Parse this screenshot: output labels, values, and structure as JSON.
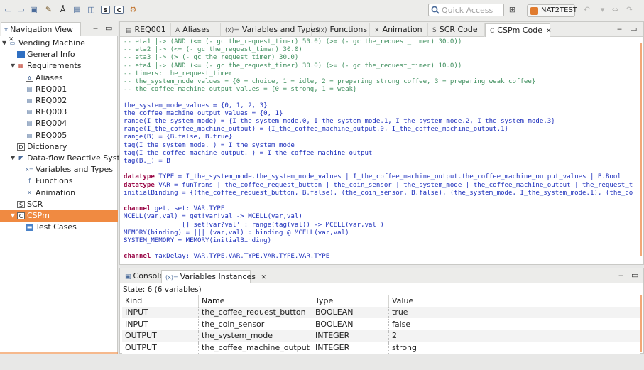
{
  "toolbar": {
    "quick_access_placeholder": "Quick Access",
    "perspective_label": "NAT2TEST"
  },
  "nav": {
    "title": "Navigation View",
    "items": [
      {
        "label": "Vending Machine",
        "icon": "project-icon"
      },
      {
        "label": "General Info",
        "icon": "info-icon"
      },
      {
        "label": "Requirements",
        "icon": "requirements-icon"
      },
      {
        "label": "Aliases",
        "icon": "alias-icon"
      },
      {
        "label": "REQ001",
        "icon": "req-icon"
      },
      {
        "label": "REQ002",
        "icon": "req-icon"
      },
      {
        "label": "REQ003",
        "icon": "req-icon"
      },
      {
        "label": "REQ004",
        "icon": "req-icon"
      },
      {
        "label": "REQ005",
        "icon": "req-icon"
      },
      {
        "label": "Dictionary",
        "icon": "dictionary-icon"
      },
      {
        "label": "Data-flow Reactive System",
        "icon": "dfrs-icon"
      },
      {
        "label": "Variables and Types",
        "icon": "variables-icon"
      },
      {
        "label": "Functions",
        "icon": "functions-icon"
      },
      {
        "label": "Animation",
        "icon": "animation-icon"
      },
      {
        "label": "SCR",
        "icon": "scr-icon"
      },
      {
        "label": "CSPm",
        "icon": "cspm-icon"
      },
      {
        "label": "Test Cases",
        "icon": "testcases-icon"
      }
    ]
  },
  "editor": {
    "tabs": [
      {
        "label": "REQ001",
        "glyph": "▤"
      },
      {
        "label": "Aliases",
        "glyph": "A"
      },
      {
        "label": "Variables and Types",
        "glyph": "(x)="
      },
      {
        "label": "Functions",
        "glyph": "f(x)"
      },
      {
        "label": "Animation",
        "glyph": "✕"
      },
      {
        "label": "SCR Code",
        "glyph": "S"
      },
      {
        "label": "CSPm Code",
        "glyph": "C"
      }
    ],
    "code": [
      [
        [
          "cmt",
          "-- eta1 |-> (AND (<= (- gc the_request_timer) 50.0) (>= (- gc the_request_timer) 30.0))"
        ]
      ],
      [
        [
          "cmt",
          "-- eta2 |-> (<= (- gc the_request_timer) 30.0)"
        ]
      ],
      [
        [
          "cmt",
          "-- eta3 |-> (> (- gc the_request_timer) 30.0)"
        ]
      ],
      [
        [
          "cmt",
          "-- eta4 |-> (AND (<= (- gc the_request_timer) 30.0) (>= (- gc the_request_timer) 10.0))"
        ]
      ],
      [
        [
          "cmt",
          "-- timers: the_request_timer"
        ]
      ],
      [
        [
          "cmt",
          "-- the_system_mode values = {0 = choice, 1 = idle, 2 = preparing strong coffee, 3 = preparing weak coffee}"
        ]
      ],
      [
        [
          "cmt",
          "-- the_coffee_machine_output values = {0 = strong, 1 = weak}"
        ]
      ],
      [],
      [
        [
          "",
          "the_system_mode_values = {0, 1, 2, 3}"
        ]
      ],
      [
        [
          "",
          "the_coffee_machine_output_values = {0, 1}"
        ]
      ],
      [
        [
          "",
          "range(I_the_system_mode) = {I_the_system_mode.0, I_the_system_mode.1, I_the_system_mode.2, I_the_system_mode.3}"
        ]
      ],
      [
        [
          "",
          "range(I_the_coffee_machine_output) = {I_the_coffee_machine_output.0, I_the_coffee_machine_output.1}"
        ]
      ],
      [
        [
          "",
          "range(B) = {B.false, B.true}"
        ]
      ],
      [
        [
          "",
          "tag(I_the_system_mode._) = I_the_system_mode"
        ]
      ],
      [
        [
          "",
          "tag(I_the_coffee_machine_output._) = I_the_coffee_machine_output"
        ]
      ],
      [
        [
          "",
          "tag(B._) = B"
        ]
      ],
      [],
      [
        [
          "kw",
          "datatype"
        ],
        [
          "",
          " TYPE = I_the_system_mode.the_system_mode_values | I_the_coffee_machine_output.the_coffee_machine_output_values | B.Bool"
        ]
      ],
      [
        [
          "kw",
          "datatype"
        ],
        [
          "",
          " VAR = funTrans | the_coffee_request_button | the_coin_sensor | the_system_mode | the_coffee_machine_output | the_request_t"
        ]
      ],
      [
        [
          "",
          "initialBinding = {(the_coffee_request_button, B.false), (the_coin_sensor, B.false), (the_system_mode, I_the_system_mode.1), (the_co"
        ]
      ],
      [],
      [
        [
          "kw",
          "channel"
        ],
        [
          "",
          " get, set: VAR.TYPE"
        ]
      ],
      [
        [
          "",
          "MCELL(var,val) = get!var!val -> MCELL(var,val)"
        ]
      ],
      [
        [
          "",
          "               [] set!var?val' : range(tag(val)) -> MCELL(var,val')"
        ]
      ],
      [
        [
          "",
          "MEMORY(binding) = ||| (var,val) : binding @ MCELL(var,val)"
        ]
      ],
      [
        [
          "",
          "SYSTEM_MEMORY = MEMORY(initialBinding)"
        ]
      ],
      [],
      [
        [
          "kw",
          "channel"
        ],
        [
          "",
          " maxDelay: VAR.TYPE.VAR.TYPE.VAR.TYPE.VAR.TYPE"
        ]
      ]
    ]
  },
  "bottom": {
    "tabs": [
      {
        "label": "Console"
      },
      {
        "label": "Variables Instances"
      }
    ],
    "state_text": "State: 6 (6 variables)",
    "columns": [
      "Kind",
      "Name",
      "Type",
      "Value"
    ],
    "rows": [
      [
        "INPUT",
        "the_coffee_request_button",
        "BOOLEAN",
        "true"
      ],
      [
        "INPUT",
        "the_coin_sensor",
        "BOOLEAN",
        "false"
      ],
      [
        "OUTPUT",
        "the_system_mode",
        "INTEGER",
        "2"
      ],
      [
        "OUTPUT",
        "the_coffee_machine_output",
        "INTEGER",
        "strong"
      ]
    ]
  },
  "colors": {
    "selection": "#f08a41",
    "comment": "#3f8f5e",
    "keyword": "#9b0a49",
    "code_blue": "#1d2fbc"
  }
}
